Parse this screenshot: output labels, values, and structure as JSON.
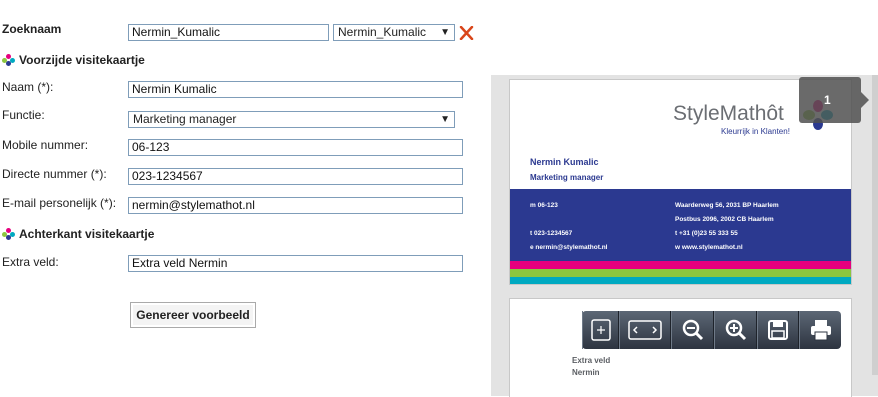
{
  "search": {
    "label": "Zoeknaam",
    "input_value": "Nermin_Kumalic",
    "select_value": "Nermin_Kumalic"
  },
  "front_section": {
    "title": "Voorzijde visitekaartje"
  },
  "fields": {
    "naam": {
      "label": "Naam (*):",
      "value": "Nermin Kumalic"
    },
    "functie": {
      "label": "Functie:",
      "value": "Marketing manager"
    },
    "mobile": {
      "label": "Mobile nummer:",
      "value": "06-123"
    },
    "direct": {
      "label": "Directe nummer (*):",
      "value": "023-1234567"
    },
    "email": {
      "label": "E-mail personelijk (*):",
      "value": "nermin@stylemathot.nl"
    }
  },
  "back_section": {
    "title": "Achterkant visitekaartje"
  },
  "extra": {
    "label": "Extra veld:",
    "value": "Extra veld Nermin"
  },
  "generate_button": "Genereer voorbeeld",
  "preview": {
    "page_number": "1",
    "logo_text": "StyleMathôt",
    "tagline": "Kleurrijk in Klanten!",
    "card_name": "Nermin Kumalic",
    "card_function": "Marketing manager",
    "card_mobile": "m  06-123",
    "card_phone": "t   023-1234567",
    "card_email": "e  nermin@stylemathot.nl",
    "address_1": "Waarderweg 56, 2031 BP  Haarlem",
    "address_2": "Postbus 2096, 2002 CB  Haarlem",
    "company_phone": "t  +31 (0)23 55 333 55",
    "website": "w  www.stylemathot.nl",
    "back_line_1": "Extra veld",
    "back_line_2": "Nermin"
  },
  "colors": {
    "card_blue": "#2b3990",
    "magenta": "#e6007e",
    "green": "#8cc63f",
    "cyan": "#00a9c1",
    "delete_red": "#d9461a"
  }
}
